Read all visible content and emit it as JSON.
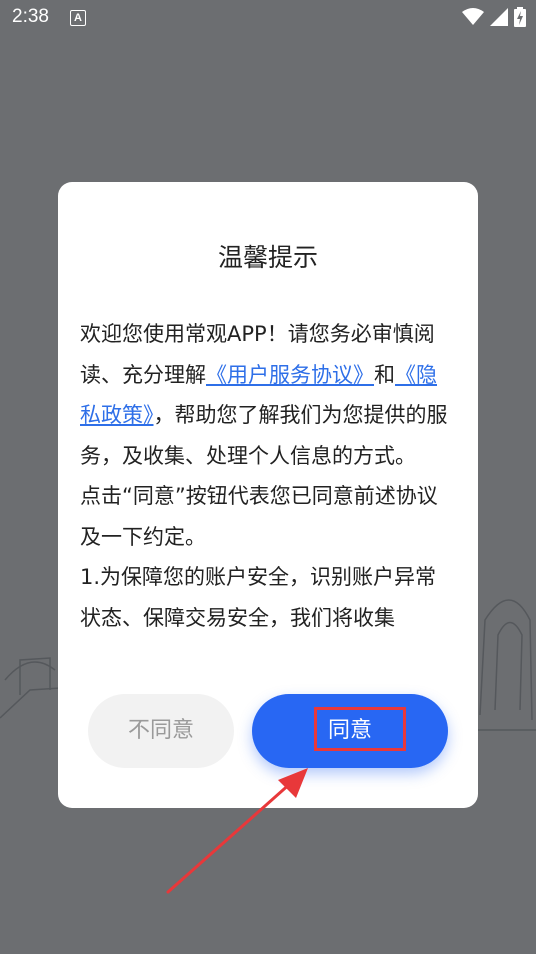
{
  "status_bar": {
    "time": "2:38",
    "notification_glyph": "A",
    "icons": [
      "wifi-icon",
      "signal-icon",
      "battery-charging-icon"
    ]
  },
  "dialog": {
    "title": "温馨提示",
    "body": {
      "p1_text1": "欢迎您使用常观APP！请您务必审慎阅读、充分理解",
      "link_user_agreement": "《用户服务协议》",
      "conjunction": "和",
      "link_privacy_policy": "《隐私政策》",
      "p1_text2": "，帮助您了解我们为您提供的服务，及收集、处理个人信息的方式。",
      "p2": "点击“同意”按钮代表您已同意前述协议及一下约定。",
      "p3": "1.为保障您的账户安全，识别账户异常状态、保障交易安全，我们将收集"
    },
    "buttons": {
      "disagree": "不同意",
      "agree": "同意"
    }
  },
  "colors": {
    "overlay": "#6c6e71",
    "link": "#2e6fe8",
    "agree_button": "#2867f3",
    "annotation": "#e8383a"
  }
}
